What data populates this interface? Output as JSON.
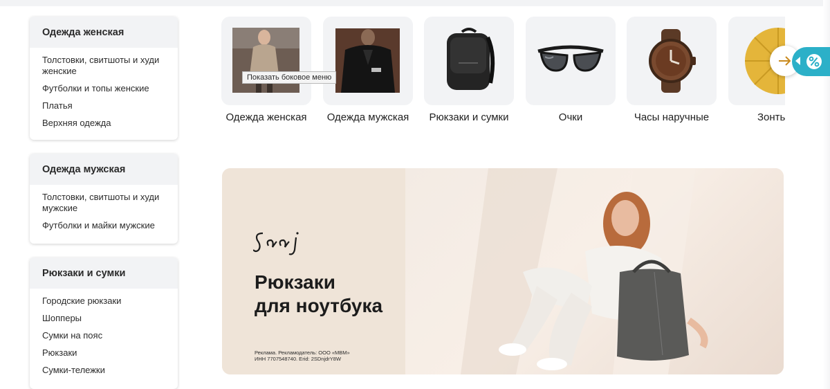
{
  "sidebar": {
    "women": {
      "title": "Одежда женская",
      "links": [
        "Толстовки, свитшоты и худи женские",
        "Футболки и топы женские",
        "Платья",
        "Верхняя одежда"
      ]
    },
    "men": {
      "title": "Одежда мужская",
      "links": [
        "Толстовки, свитшоты и худи мужские",
        "Футболки и майки мужские"
      ]
    },
    "bags": {
      "title": "Рюкзаки и сумки",
      "links": [
        "Городские рюкзаки",
        "Шопперы",
        "Сумки на пояс",
        "Рюкзаки",
        "Сумки-тележки"
      ]
    }
  },
  "categories": [
    {
      "label": "Одежда женская",
      "icon": "women-clothing-photo"
    },
    {
      "label": "Одежда мужская",
      "icon": "men-clothing-photo"
    },
    {
      "label": "Рюкзаки и сумки",
      "icon": "backpack-photo"
    },
    {
      "label": "Очки",
      "icon": "sunglasses-photo"
    },
    {
      "label": "Часы наручные",
      "icon": "wristwatch-photo"
    },
    {
      "label": "Зонть",
      "icon": "umbrella-photo"
    }
  ],
  "tooltip": "Показать боковое меню",
  "promo_tab": {
    "symbol": "%",
    "color": "#2cb0c8"
  },
  "banner": {
    "brand": "Saaj",
    "title_line1": "Рюкзаки",
    "title_line2": "для ноутбука",
    "ad_line1": "Реклама. Рекламодатель: ООО «МВМ»",
    "ad_line2": "ИНН 7707548740. Erid: 2SDnjdrY8W"
  }
}
